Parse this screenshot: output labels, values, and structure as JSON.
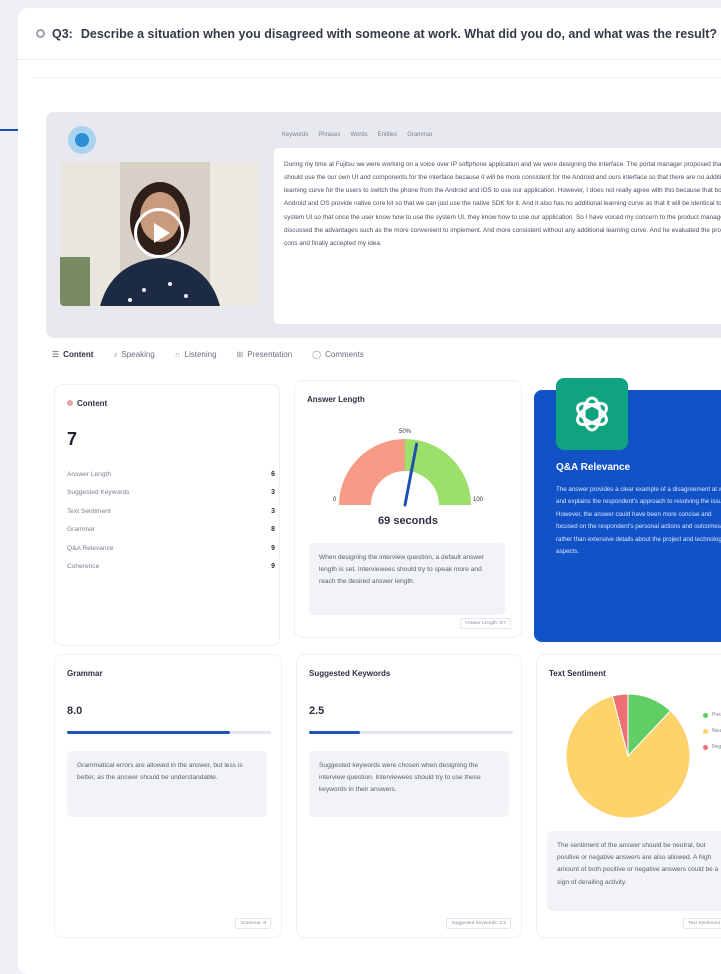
{
  "question": {
    "number": "Q3:",
    "text": "Describe a situation when you disagreed with someone at work. What did you do, and what was the result?"
  },
  "media": {
    "tabs": [
      "Keywords",
      "Phrases",
      "Words",
      "Entities",
      "Grammar"
    ],
    "transcript": "During my time at Fujitsu we were working on a voice over IP softphone application and we were designing the interface. The portal manager proposed that we should use the our own UI and components for the interface because it will be more consistent for the Android and ours interface so that there are no additional learning curve for the users to switch the phone from the Android and iOS to use our application. However, I does not really agree with this because that both the Android and OS provide native core kit so that we can just use the native SDK for it. And it also has no additional learning curve as that it will be identical to the system UI so that once the user know how to use the system UI, they know how to use our application. So I have voiced my concern to the product manager and discussed the advantages such as the more convenient to implement. And more consistent without any additional learning curve. And he evaluated the pros and cons and finally accepted my idea."
  },
  "tabs": [
    {
      "label": "Content",
      "icon": "list-icon"
    },
    {
      "label": "Speaking",
      "icon": "mic-icon"
    },
    {
      "label": "Listening",
      "icon": "headphones-icon"
    },
    {
      "label": "Presentation",
      "icon": "presentation-icon"
    },
    {
      "label": "Comments",
      "icon": "comment-icon"
    }
  ],
  "content_card": {
    "title": "Content",
    "score": "7",
    "metrics": [
      {
        "label": "Answer Length",
        "value": "6"
      },
      {
        "label": "Suggested Keywords",
        "value": "3"
      },
      {
        "label": "Text Sentiment",
        "value": "3"
      },
      {
        "label": "Grammar",
        "value": "8"
      },
      {
        "label": "Q&A Relevance",
        "value": "9"
      },
      {
        "label": "Coherence",
        "value": "9"
      }
    ]
  },
  "answer_length": {
    "title": "Answer Length",
    "seconds_label": "69 seconds",
    "gauge_top_label": "50%",
    "gauge_left_label": "0",
    "gauge_right_label": "100",
    "needle_fraction": 0.56,
    "note": "When designing the interview question, a default answer length is set. Interviewees should try to speak more and reach the desired answer length.",
    "footer": "Answer Length: 6/7"
  },
  "qa_relevance": {
    "title": "Q&A Relevance",
    "text": "The answer provides a clear example of a disagreement at work and explains the respondent's approach to resolving the issue. However, the answer could have been more concise and focused on the respondent's personal actions and outcomes, rather than extensive details about the project and technological aspects."
  },
  "grammar": {
    "title": "Grammar",
    "value": "8.0",
    "fill_fraction": 0.8,
    "note": "Grammatical errors are allowed in the answer, but less is better, as the answer should be understandable.",
    "footer": "Grammar: 8"
  },
  "keywords": {
    "title": "Suggested Keywords",
    "value": "2.5",
    "fill_fraction": 0.25,
    "note": "Suggested keywords were chosen when designing the interview question. Interviewees should try to use these keywords in their answers.",
    "footer": "Suggested Keywords: 2.5"
  },
  "sentiment": {
    "title": "Text Sentiment",
    "slices": [
      {
        "name": "Positive",
        "value": 12,
        "color": "#5fcf65"
      },
      {
        "name": "Neutral",
        "value": 84,
        "color": "#fdd46b"
      },
      {
        "name": "Negative",
        "value": 4,
        "color": "#ef7074"
      }
    ],
    "note": "The sentiment of the answer should be neutral, but positive or negative answers are also allowed. A high amount of both positive or negative answers could be a sign of derailing activity.",
    "footer": "Text Sentiment"
  }
}
